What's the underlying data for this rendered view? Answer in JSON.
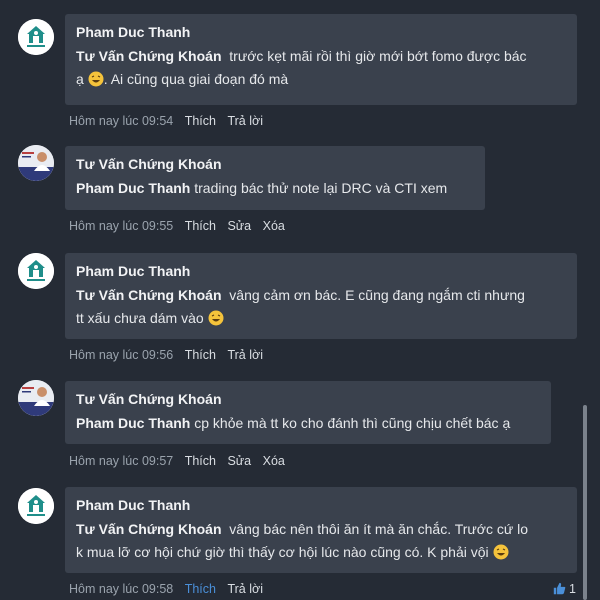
{
  "comments": [
    {
      "avatar_icon": "house-logo-icon",
      "author": "Pham Duc Thanh",
      "mention": "Tư Vấn Chứng Khoán",
      "text_line1": "  trước kẹt mãi rồi thì giờ mới bớt fomo được bác",
      "text_line2": "ạ",
      "text_line2b": ". Ai cũng qua giai đoạn đó mà",
      "time": "Hôm nay lúc 09:54",
      "actions": [
        "Thích",
        "Trả lời"
      ]
    },
    {
      "avatar_icon": "advisor-portrait-icon",
      "author": "Tư Vấn Chứng Khoán",
      "mention": "Pham Duc Thanh",
      "text_line1": " trading bác thử note lại DRC và CTI xem",
      "time": "Hôm nay lúc 09:55",
      "actions": [
        "Thích",
        "Sửa",
        "Xóa"
      ]
    },
    {
      "avatar_icon": "house-logo-icon",
      "author": "Pham Duc Thanh",
      "mention": "Tư Vấn Chứng Khoán",
      "text_line1": "  vâng cảm ơn bác. E cũng đang ngắm cti nhưng",
      "text_line2": "tt xấu chưa dám vào ",
      "time": "Hôm nay lúc 09:56",
      "actions": [
        "Thích",
        "Trả lời"
      ]
    },
    {
      "avatar_icon": "advisor-portrait-icon",
      "author": "Tư Vấn Chứng Khoán",
      "mention": "Pham Duc Thanh",
      "text_line1": " cp khỏe mà tt ko cho đánh thì cũng chịu chết bác ạ",
      "time": "Hôm nay lúc 09:57",
      "actions": [
        "Thích",
        "Sửa",
        "Xóa"
      ]
    },
    {
      "avatar_icon": "house-logo-icon",
      "author": "Pham Duc Thanh",
      "mention": "Tư Vấn Chứng Khoán",
      "text_line1": "  vâng bác nên thôi ăn ít mà ăn chắc. Trước cứ lo",
      "text_line2": "k mua lỡ cơ hội chứ giờ thì thấy cơ hội lúc nào cũng có. K phải vội ",
      "time": "Hôm nay lúc 09:58",
      "actions": [
        "Thích",
        "Trả lời"
      ],
      "like_count": "1"
    }
  ],
  "colors": {
    "background": "#252b35",
    "bubble": "#3a414d",
    "liked": "#4a8fd8"
  }
}
